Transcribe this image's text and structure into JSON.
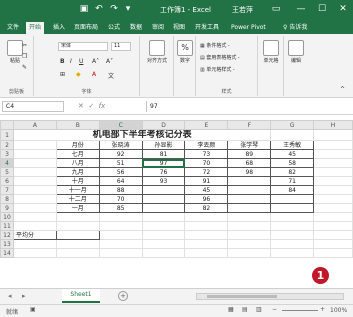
{
  "titlebar": {
    "title": "工作簿1 - Excel",
    "user": "王若萍"
  },
  "tabs": [
    "文件",
    "开始",
    "插入",
    "页面布局",
    "公式",
    "数据",
    "审阅",
    "视图",
    "开发工具",
    "Power Pivot",
    "告诉我"
  ],
  "ribbon": {
    "paste_label": "粘贴",
    "clipboard_group": "剪贴板",
    "font_name": "宋体",
    "font_size": "11",
    "font_group": "字体",
    "align_label": "对齐方式",
    "number_label": "数字",
    "percent_symbol": "%",
    "style_items": [
      "条件格式 -",
      "套用表格格式 -",
      "单元格样式 -"
    ],
    "style_group": "样式",
    "cell_label": "单元格",
    "edit_label": "编辑"
  },
  "formula_bar": {
    "name_box": "C4",
    "formula": "97"
  },
  "sheet": {
    "columns": [
      "A",
      "B",
      "C",
      "D",
      "E",
      "F",
      "G",
      "H"
    ],
    "rows": [
      "1",
      "2",
      "3",
      "4",
      "5",
      "6",
      "7",
      "8",
      "9",
      "10",
      "11",
      "12",
      "13",
      "14"
    ],
    "title": "机电部下半年考核记分表",
    "headers": [
      "月份",
      "张晓涛",
      "孙显影",
      "李丟颜",
      "张学琴",
      "王秀敏"
    ],
    "data": [
      [
        "七月",
        "92",
        "81",
        "73",
        "89",
        "45"
      ],
      [
        "八月",
        "51",
        "97",
        "70",
        "68",
        "58"
      ],
      [
        "九月",
        "56",
        "76",
        "72",
        "98",
        "82"
      ],
      [
        "十月",
        "64",
        "93",
        "91",
        "",
        "71"
      ],
      [
        "十一月",
        "88",
        "",
        "45",
        "",
        "84"
      ],
      [
        "十二月",
        "70",
        "",
        "96",
        "",
        ""
      ],
      [
        "一月",
        "85",
        "",
        "82",
        "",
        ""
      ]
    ],
    "avg_label": "平均分"
  },
  "sheet_tab": "Sheet1",
  "badge": "1",
  "status": {
    "ready": "就绪",
    "zoom": "100%"
  }
}
